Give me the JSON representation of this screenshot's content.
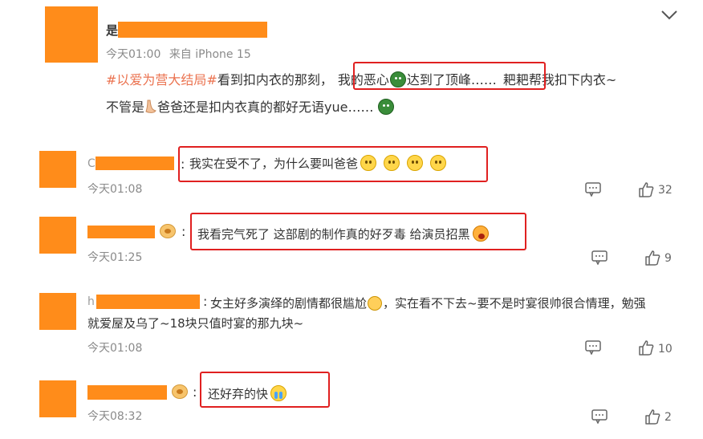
{
  "main_post": {
    "name_first_char": "是",
    "time": "今天01:00",
    "source": "来自 iPhone 15",
    "hashtag": "#以爱为营大结局#",
    "text_a": "看到扣内衣的那刻，",
    "text_b": "我的恶心",
    "text_c": "达到了顶峰",
    "text_d": "……",
    "text_e": "耙耙帮我扣下内衣~",
    "line2_a": "不管是",
    "line2_b": "爸爸还是扣内衣真的都好无语yue……"
  },
  "replies": [
    {
      "name_first_char": "C",
      "colon": ":",
      "text": "我实在受不了，为什么要叫爸爸",
      "time": "今天01:08",
      "likes": "32"
    },
    {
      "name_first_char": "",
      "colon": ":",
      "text": "我看完气死了 这部剧的制作真的好歹毒 给演员招黑",
      "time": "今天01:25",
      "likes": "9"
    },
    {
      "name_first_char": "h",
      "colon": ":",
      "text": "女主好多演绎的剧情都很尴尬",
      "text_b": "，实在看不下去~要不是时宴很帅很合情理，勉强",
      "text_line2": "就爱屋及乌了~18块只值时宴的那九块~",
      "time": "今天01:08",
      "likes": "10"
    },
    {
      "name_first_char": "",
      "colon": ":",
      "text": "还好弃的快",
      "time": "今天08:32",
      "likes": "2"
    }
  ],
  "icons": {
    "collapse": "chevron-down-icon",
    "comment": "comment-icon",
    "like": "thumbs-up-icon"
  },
  "colors": {
    "mask": "#ff8c1a",
    "highlight": "#e02020",
    "hashtag": "#eb7350"
  }
}
